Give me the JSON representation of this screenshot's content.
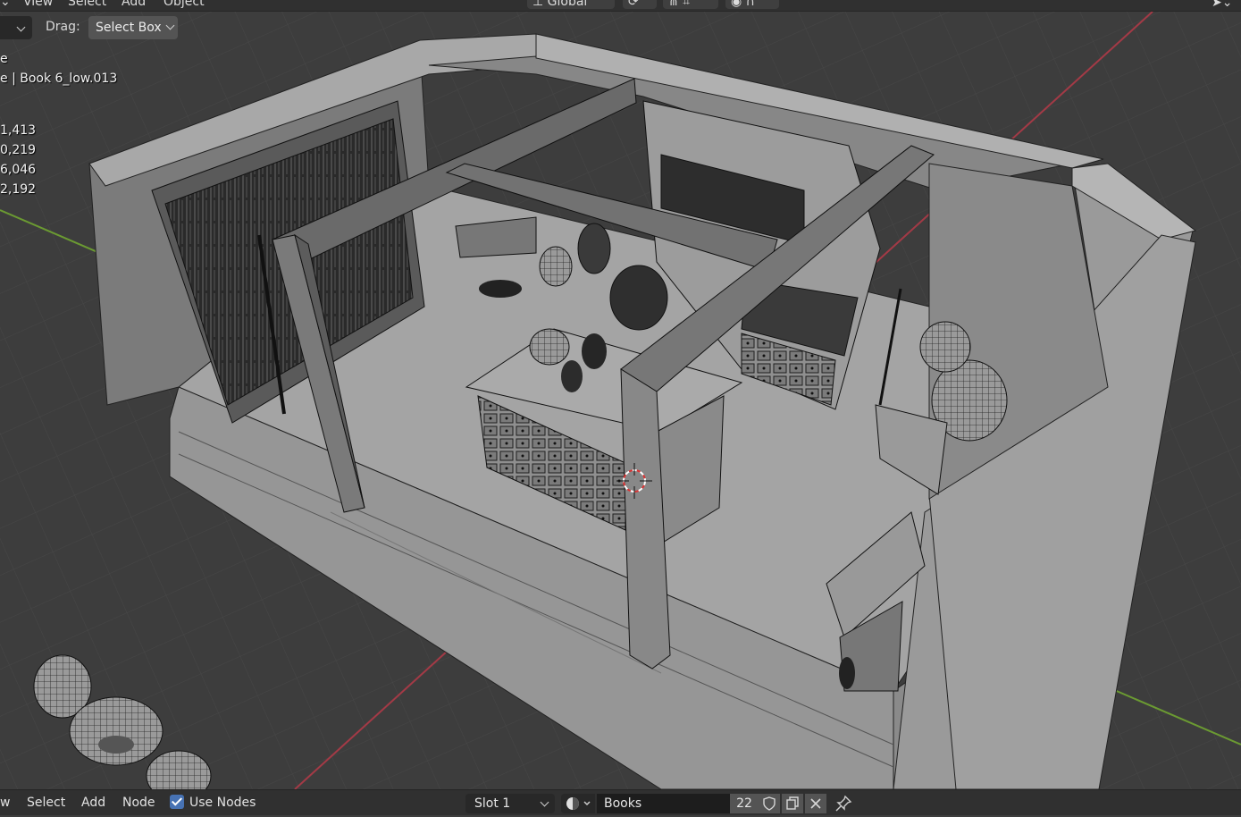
{
  "header": {
    "menus": [
      "View",
      "Select",
      "Add",
      "Object"
    ],
    "orientation": "Global"
  },
  "toolbar": {
    "drag_label": "Drag:",
    "drag_value": "Select Box"
  },
  "overlay": {
    "mode_partial": "e",
    "selection_partial": "e | Book 6_low.013",
    "stats_partial": [
      "1,413",
      "0,219",
      "6,046",
      "2,192"
    ]
  },
  "bottombar": {
    "menus": [
      "w",
      "Select",
      "Add",
      "Node"
    ],
    "use_nodes_label": "Use Nodes",
    "use_nodes_checked": true,
    "slot": "Slot 1",
    "material_name": "Books",
    "material_users": "22"
  },
  "icons": [
    "transform-orientation-icon",
    "snap-icon",
    "proportional-icon",
    "material-sphere-icon",
    "fake-user-shield-icon",
    "duplicate-icon",
    "close-icon",
    "pin-icon",
    "select-cursor-icon",
    "3d-cursor-icon"
  ],
  "colors": {
    "viewport_bg": "#3d3d3d",
    "header_bg": "#303030",
    "accent_checkbox": "#4772b3",
    "x_axis": "#a33a46",
    "y_axis": "#6b9a32",
    "wall": "#8c8c8c",
    "floor": "#a6a6a6"
  }
}
